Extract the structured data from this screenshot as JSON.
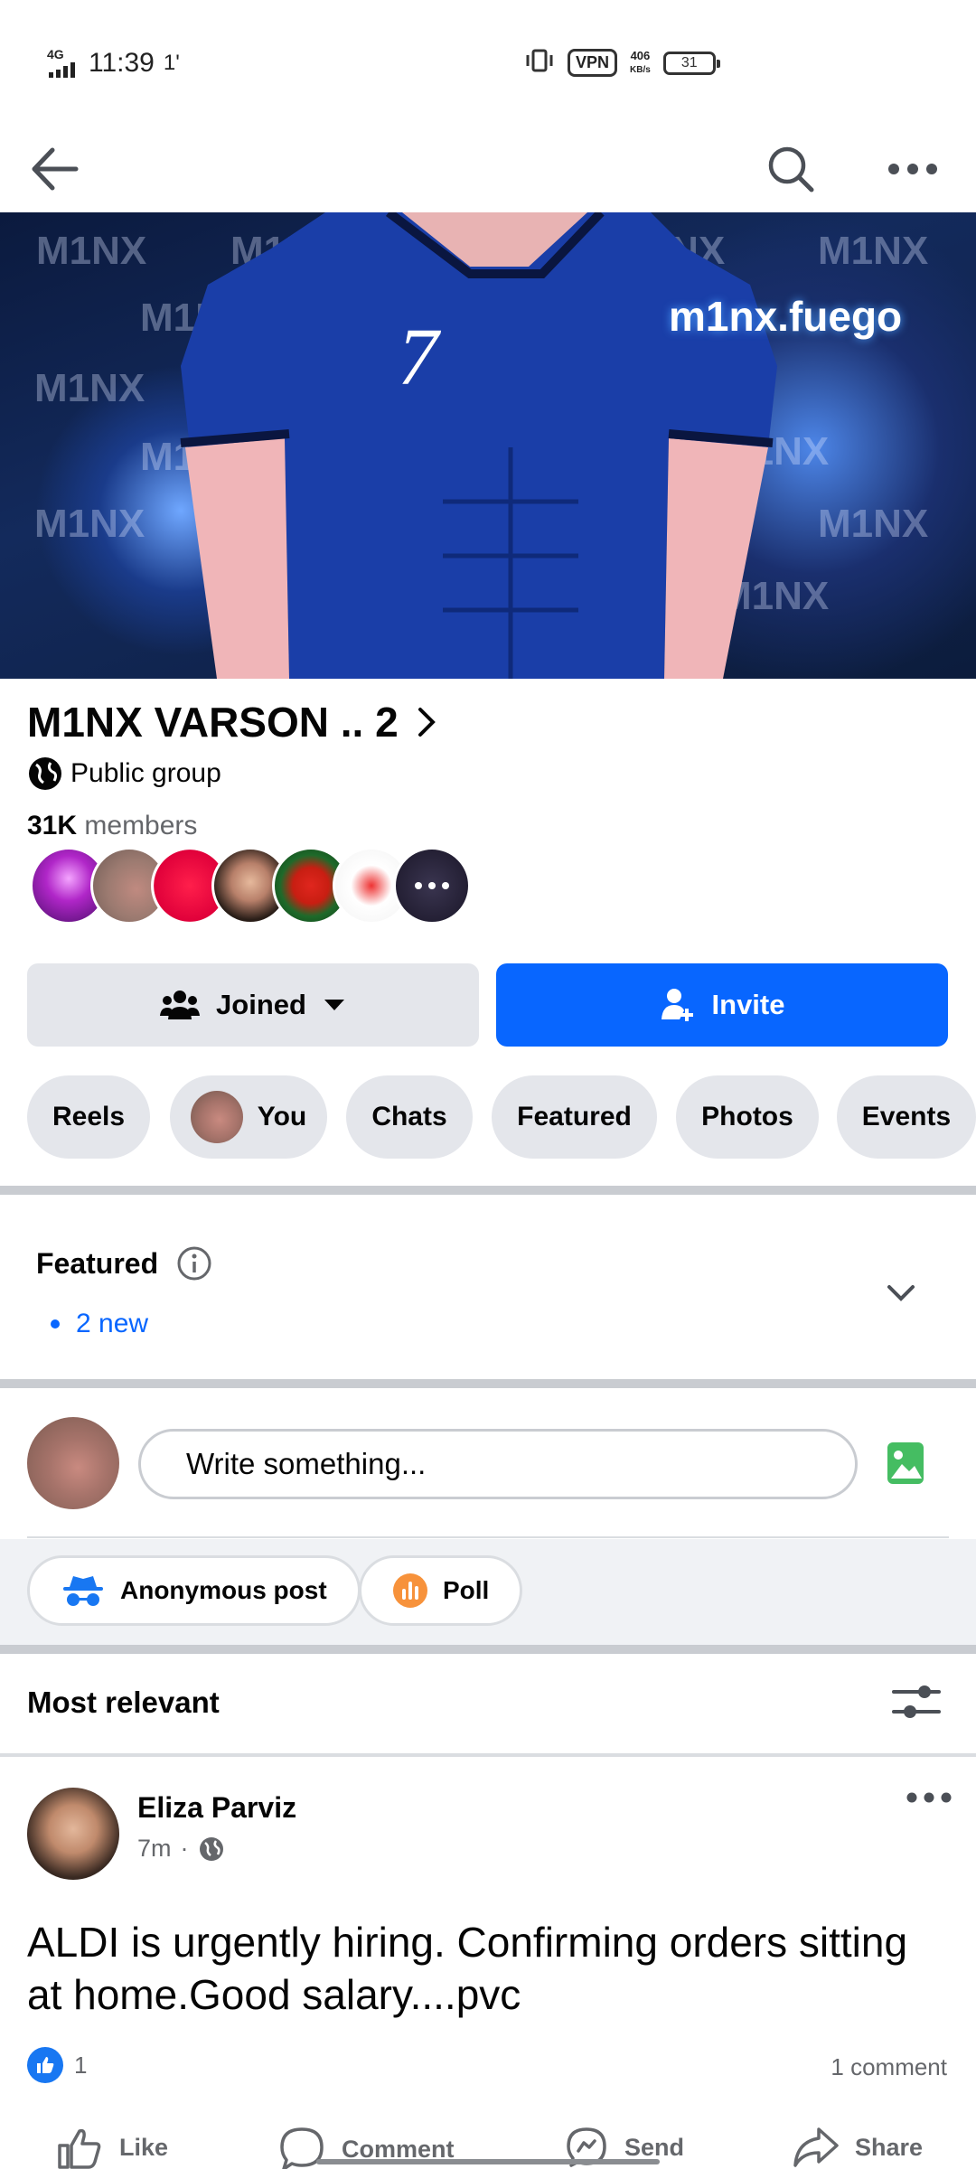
{
  "status_bar": {
    "network": "4G",
    "time": "11:39",
    "notif": "1'",
    "vpn": "VPN",
    "speed_value": "406",
    "speed_unit": "KB/s",
    "battery": "31"
  },
  "nav": {
    "back_icon": "arrow-left-icon",
    "search_icon": "search-icon",
    "more_icon": "more-horizontal-icon"
  },
  "cover": {
    "watermark": "M1NX",
    "handle": "m1nx.fuego",
    "jersey_number": "7"
  },
  "group": {
    "name": "M1NX VARSON .. 2",
    "privacy": "Public group",
    "member_count": "31K",
    "member_label": "members"
  },
  "buttons": {
    "joined": "Joined",
    "invite": "Invite"
  },
  "tabs": [
    {
      "label": "Reels"
    },
    {
      "label": "You"
    },
    {
      "label": "Chats"
    },
    {
      "label": "Featured"
    },
    {
      "label": "Photos"
    },
    {
      "label": "Events"
    }
  ],
  "featured": {
    "title": "Featured",
    "new_label": "2 new"
  },
  "composer": {
    "placeholder": "Write something...",
    "options": [
      {
        "label": "Anonymous post"
      },
      {
        "label": "Poll"
      }
    ]
  },
  "sort": {
    "label": "Most relevant"
  },
  "post": {
    "author": "Eliza Parviz",
    "time": "7m",
    "separator": "·",
    "text": "ALDI  is urgently hiring. Confirming orders sitting at home.Good salary....pvc",
    "like_count": "1",
    "comment_count": "1 comment",
    "actions": {
      "like": "Like",
      "comment": "Comment",
      "send": "Send",
      "share": "Share"
    }
  },
  "colors": {
    "accent": "#0866ff",
    "chip_bg": "#e4e6eb",
    "secondary_text": "#65676b"
  }
}
